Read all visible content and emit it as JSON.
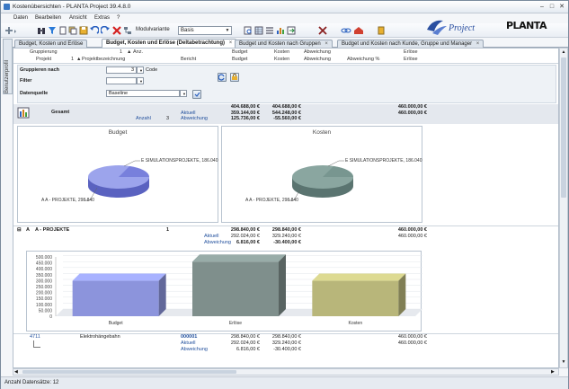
{
  "window": {
    "title": "Kostenübersichten - PLANTA Project 39.4.8.0",
    "minimize": "–",
    "maximize": "□",
    "close": "✕"
  },
  "menu": [
    "Daten",
    "Bearbeiten",
    "Ansicht",
    "Extras",
    "?"
  ],
  "toolbar": {
    "variant_label": "Modulvariante",
    "variant_value": "Basis",
    "brand_text": "Project",
    "planta_logo": "PLANTA"
  },
  "side_panel": {
    "label": "Benutzerprofil"
  },
  "tabs": [
    {
      "label": "Budget, Kosten und Erlöse",
      "active": false
    },
    {
      "label": "Budget, Kosten und Erlöse (Deltabetrachtung)",
      "active": true
    },
    {
      "label": "Budget und Kosten nach Gruppen",
      "active": false
    },
    {
      "label": "Budget und Kosten nach Kunde, Gruppe und Manager",
      "active": false
    }
  ],
  "tab_close": "×",
  "header": {
    "gruppierung": "Gruppierung",
    "gruppierung_val": "1",
    "anz_label": "Anz.",
    "budget1": "Budget",
    "kosten1": "Kosten",
    "abweichung1": "Abweichung",
    "erloese1": "Erlöse",
    "projekt": "Projekt",
    "projekt_val": "1",
    "projektbez": "Projektbezeichnung",
    "bericht": "Bericht",
    "budget2": "Budget",
    "kosten2": "Kosten",
    "abweichung2": "Abweichung",
    "abweichung_pct": "Abweichung %",
    "erloese2": "Erlöse"
  },
  "form": {
    "gruppieren_label": "Gruppieren nach",
    "gruppieren_num": "3",
    "gruppieren_val": "Code",
    "filter_label": "Filter",
    "datenquelle_label": "Datenquelle",
    "datenquelle_val": "Baseline"
  },
  "gesamt": {
    "label": "Gesamt",
    "anzahl_label": "Anzahl",
    "anzahl": "3",
    "aktuell_label": "Aktuell",
    "abweichung_label": "Abweichung",
    "budget": "404.688,00 €",
    "kosten": "404.688,00 €",
    "erloese": "460.000,00 €",
    "aktuell_budget": "359.144,00 €",
    "aktuell_kosten": "544.248,00 €",
    "aktuell_erloese": "460.000,00 €",
    "abw_budget": "125.736,00 €",
    "abw_kosten": "-55.560,00 €"
  },
  "pie_budget": {
    "title": "Budget",
    "label_e": "E  SIMULATIONSPROJEKTE, 186.040",
    "label_a": "A  A - PROJEKTE, 298.840"
  },
  "pie_kosten": {
    "title": "Kosten",
    "label_e": "E  SIMULATIONSPROJEKTE, 186.040",
    "label_a": "A  A - PROJEKTE, 298.840"
  },
  "group_a": {
    "code": "A",
    "name": "A - PROJEKTE",
    "count": "1",
    "budget": "298.840,00 €",
    "kosten": "298.840,00 €",
    "erloese": "460.000,00 €",
    "aktuell_label": "Aktuell",
    "aktuell_budget": "292.024,00 €",
    "aktuell_kosten": "329.240,00 €",
    "aktuell_erloese": "460.000,00 €",
    "abweichung_label": "Abweichung",
    "abw_budget": "6.816,00 €",
    "abw_kosten": "-30.400,00 €"
  },
  "chart_data": {
    "type": "bar",
    "categories": [
      "Budget",
      "Erlöse",
      "Kosten"
    ],
    "values": [
      298840,
      460000,
      298840
    ],
    "ylim": [
      0,
      500000
    ],
    "yticks": [
      "500.000",
      "450.000",
      "400.000",
      "350.000",
      "300.000",
      "250.000",
      "200.000",
      "150.000",
      "100.000",
      "50.000",
      "0"
    ],
    "colors": [
      "#8c94dc",
      "#7f8f8c",
      "#b8b67a"
    ]
  },
  "project_row": {
    "code": "4711",
    "name": "Elektrohängebahn",
    "id": "000001",
    "budget": "298.840,00 €",
    "kosten": "298.840,00 €",
    "erloese": "460.000,00 €",
    "aktuell_label": "Aktuell",
    "aktuell_budget": "292.024,00 €",
    "aktuell_kosten": "329.240,00 €",
    "aktuell_erloese": "460.000,00 €",
    "abweichung_label": "Abweichung",
    "abw_budget": "6.816,00 €",
    "abw_kosten": "-30.400,00 €"
  },
  "status": {
    "text": "Anzahl Datensätze: 12"
  }
}
